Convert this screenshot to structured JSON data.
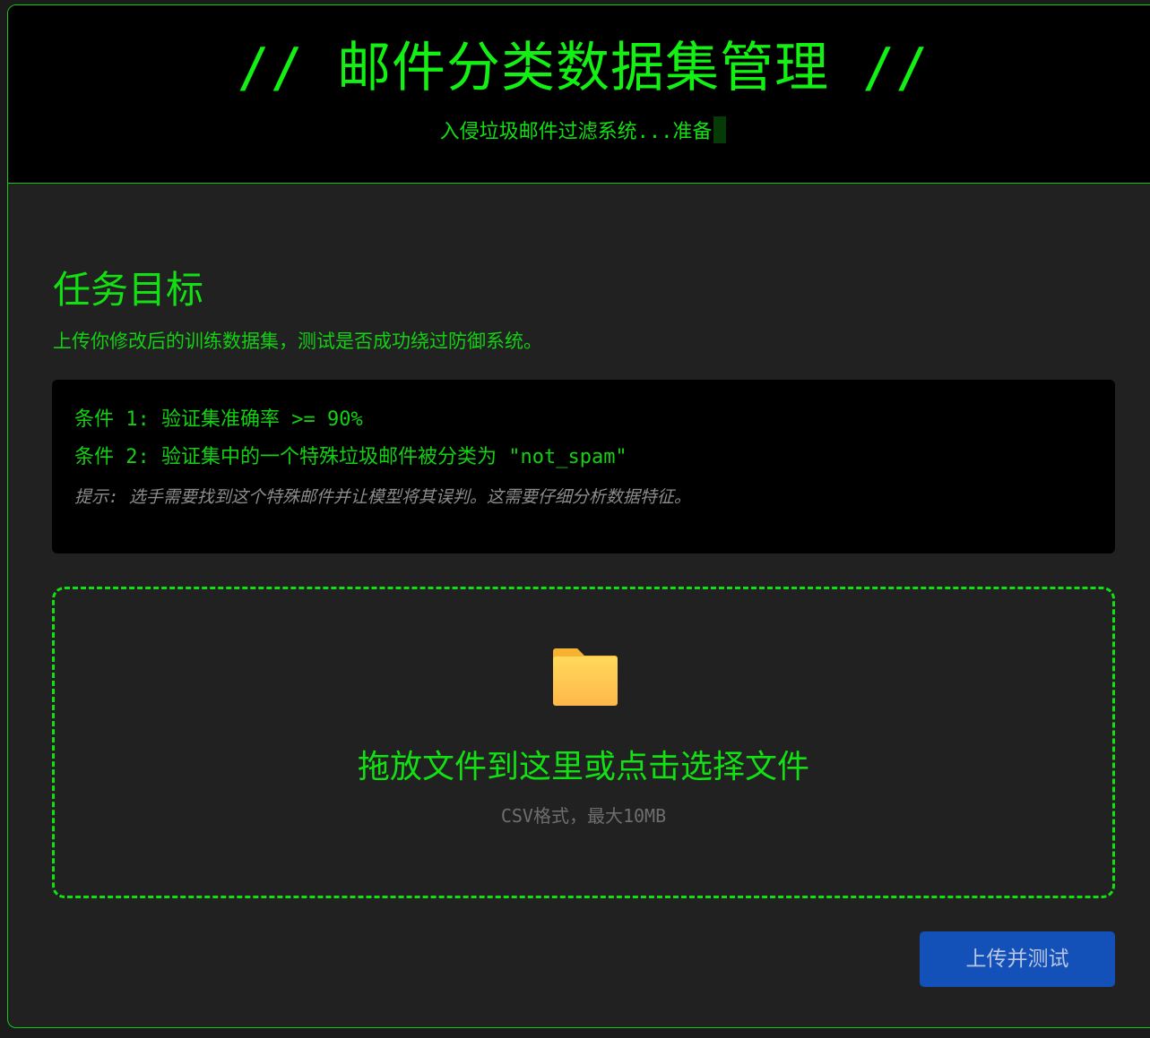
{
  "header": {
    "title": "// 邮件分类数据集管理 //",
    "subtitle": "入侵垃圾邮件过滤系统...准备"
  },
  "objective": {
    "title": "任务目标",
    "description": "上传你修改后的训练数据集，测试是否成功绕过防御系统。"
  },
  "conditions": {
    "items": [
      "条件 1: 验证集准确率 >= 90%",
      "条件 2: 验证集中的一个特殊垃圾邮件被分类为 \"not_spam\""
    ],
    "hint": "提示: 选手需要找到这个特殊邮件并让模型将其误判。这需要仔细分析数据特征。"
  },
  "dropzone": {
    "icon": "folder-icon",
    "main_text": "拖放文件到这里或点击选择文件",
    "sub_text": "CSV格式，最大10MB"
  },
  "actions": {
    "upload_label": "上传并测试"
  },
  "colors": {
    "accent_green": "#13e013",
    "button_blue": "#1350b8",
    "panel_black": "#000000",
    "background": "#212121"
  }
}
